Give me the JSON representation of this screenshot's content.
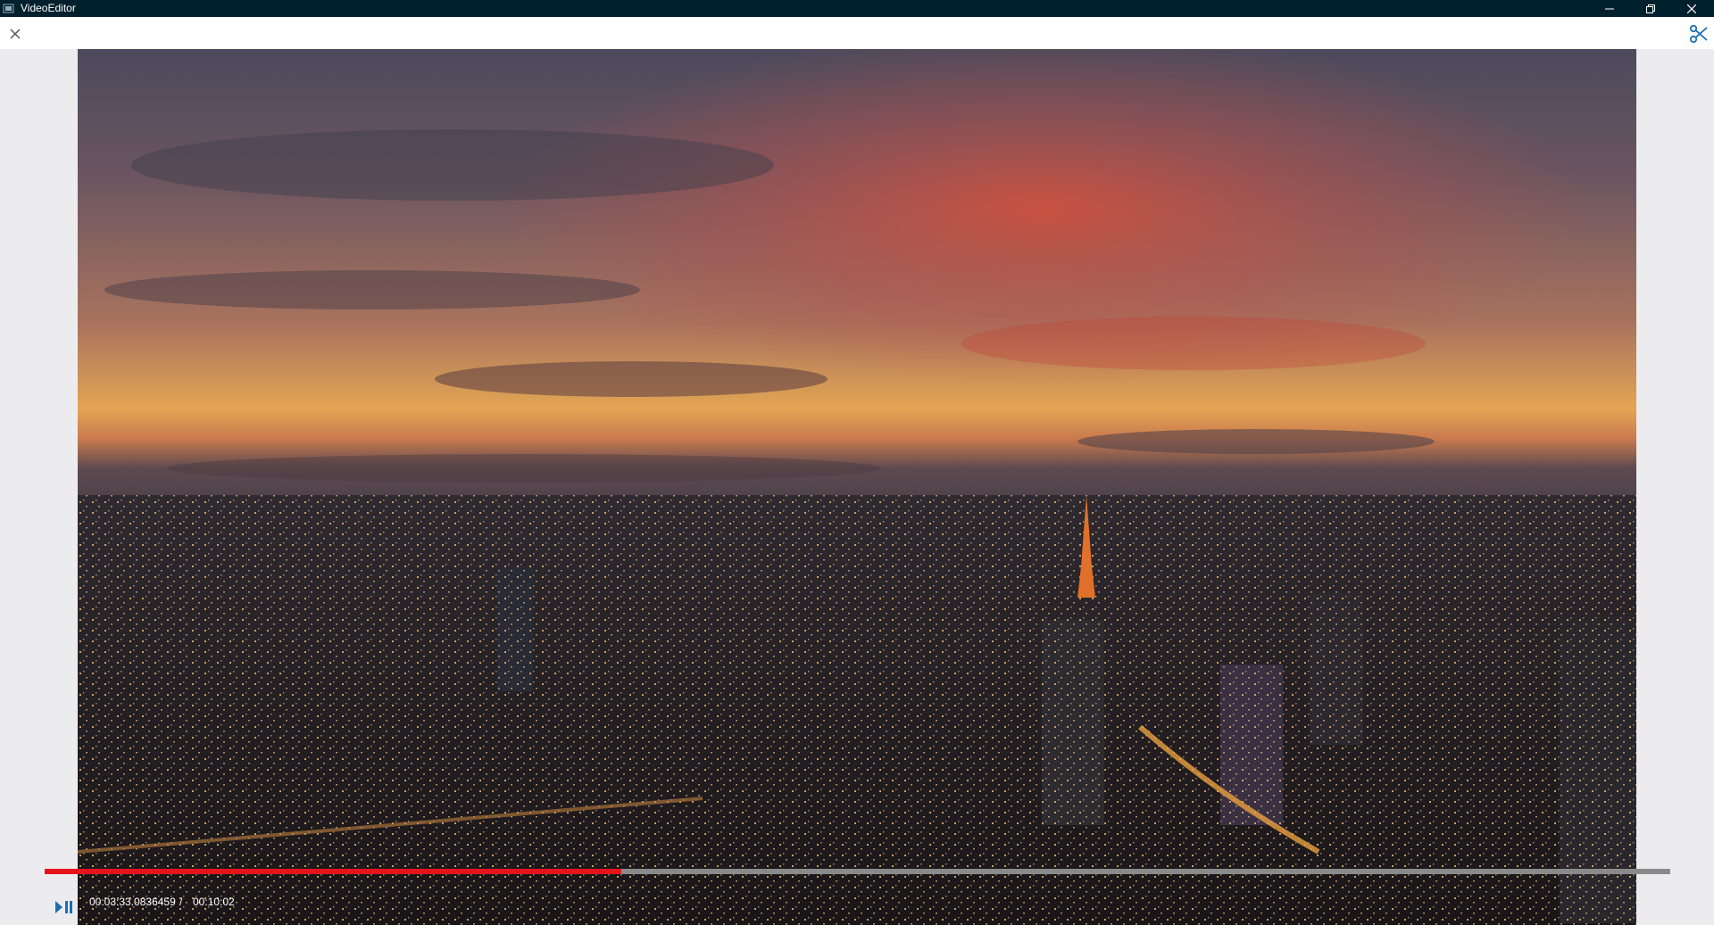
{
  "window": {
    "title": "VideoEditor",
    "icons": {
      "app": "app-icon",
      "minimize": "minimize-icon",
      "restore": "restore-icon",
      "close": "close-icon"
    }
  },
  "toolbar": {
    "close_icon": "close-icon",
    "cut_icon": "scissors-icon",
    "accent_color": "#1a6fb5"
  },
  "player": {
    "current_time": "00:03:33.0836459",
    "separator": "/",
    "total_time": "00:10:02",
    "progress_fraction": 0.355,
    "progress_color": "#e5131b",
    "track_color": "#8a8a8a",
    "play_pause_icon": "play-pause-icon"
  }
}
